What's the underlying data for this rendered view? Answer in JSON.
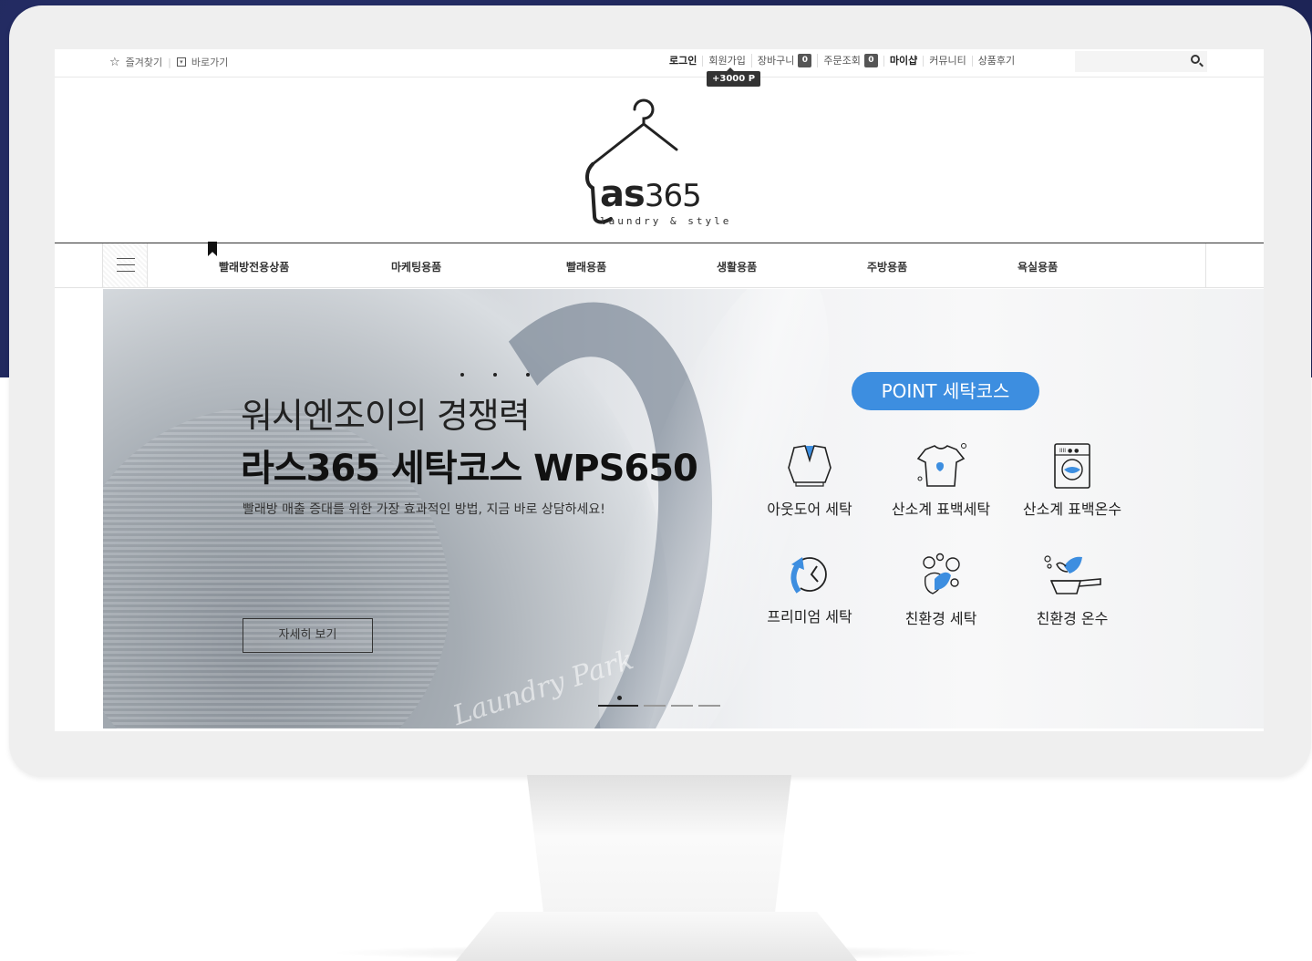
{
  "topbar": {
    "favorites": "즐겨찾기",
    "shortcut": "바로가기",
    "login": "로그인",
    "signup": "회원가입",
    "cart": "장바구니",
    "cart_count": "0",
    "order": "주문조회",
    "order_count": "0",
    "myshop": "마이샵",
    "community": "커뮤니티",
    "reviews": "상품후기",
    "point_tip": "+3000 P",
    "search_placeholder": ""
  },
  "logo": {
    "main_bold": "as",
    "main_num": "365",
    "sub": "laundry & style"
  },
  "nav": {
    "items": [
      "빨래방전용상품",
      "마케팅용품",
      "빨래용품",
      "생활용품",
      "주방용품",
      "욕실용품"
    ]
  },
  "banner": {
    "headline": "워시엔조이의 경쟁력",
    "title": "라스365 세탁코스 WPS650",
    "description": "빨래방 매출 증대를 위한 가장 효과적인 방법, 지금 바로 상담하세요!",
    "button": "자세히 보기",
    "badge": "POINT 세탁코스",
    "features": [
      "아웃도어 세탁",
      "산소계 표백세탁",
      "산소계 표백온수",
      "프리미엄 세탁",
      "친환경 세탁",
      "친환경 온수"
    ],
    "script_text": "Laundry Park",
    "slide_count": 4,
    "active_slide": 1
  },
  "colors": {
    "accent": "#3d8ee0",
    "frame_bg": "#1d2456"
  }
}
